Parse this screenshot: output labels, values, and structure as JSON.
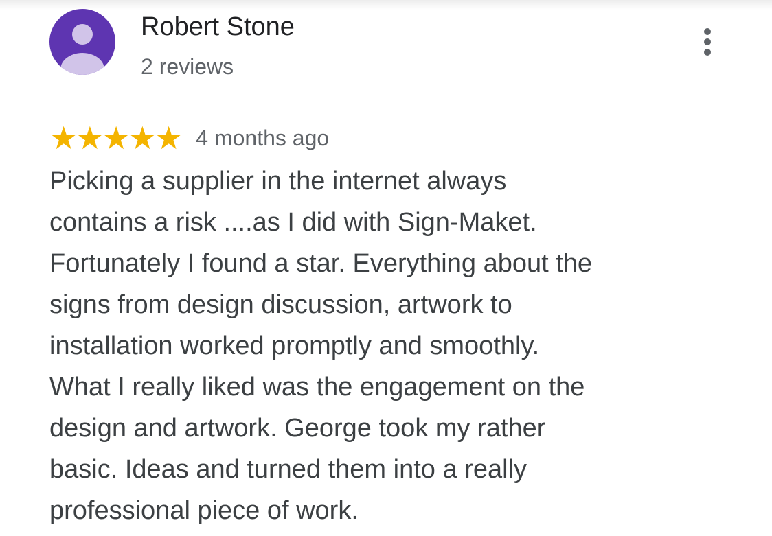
{
  "reviewer": {
    "name": "Robert Stone",
    "meta": "2 reviews",
    "avatar_icon": "person-icon"
  },
  "menu": {
    "icon": "more-vert-icon"
  },
  "rating": {
    "stars": 5,
    "max_stars": 5,
    "star_color": "#f4b400",
    "time": "4 months ago"
  },
  "review": {
    "lines": [
      "Picking a supplier in the internet always",
      "contains a risk ....as I did with Sign-Maket.",
      "Fortunately I found a star. Everything about the",
      "signs from design discussion, artwork to",
      "installation worked promptly and smoothly.",
      "What I really liked was the engagement on the",
      "design and artwork. George took my rather",
      "basic. Ideas and turned them into a really",
      "professional piece of work."
    ]
  },
  "colors": {
    "avatar_bg": "#5e35b1",
    "avatar_fg": "#d1c4e9",
    "text_primary": "#202124",
    "text_body": "#3c4043",
    "text_secondary": "#5f6368"
  }
}
